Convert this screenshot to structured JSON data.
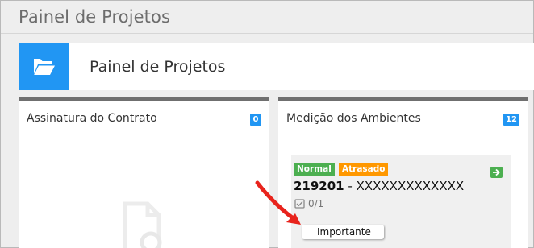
{
  "page": {
    "title": "Painel de Projetos"
  },
  "header": {
    "title": "Painel de Projetos",
    "icon": "folder-open-icon",
    "accent": "#2196f3"
  },
  "columns": [
    {
      "title": "Assinatura do Contrato",
      "count": "0",
      "empty_icon": "document-search-icon"
    },
    {
      "title": "Medição dos Ambientes",
      "count": "12",
      "cards": [
        {
          "tags": [
            {
              "label": "Normal",
              "color": "#4caf50"
            },
            {
              "label": "Atrasado",
              "color": "#ff9800"
            }
          ],
          "code": "219201",
          "separator": " - ",
          "name": "XXXXXXXXXXXXX",
          "progress": "0/1",
          "label": "Importante"
        }
      ]
    }
  ],
  "annotation": {
    "icon": "red-arrow-icon",
    "color": "#e8231c"
  }
}
